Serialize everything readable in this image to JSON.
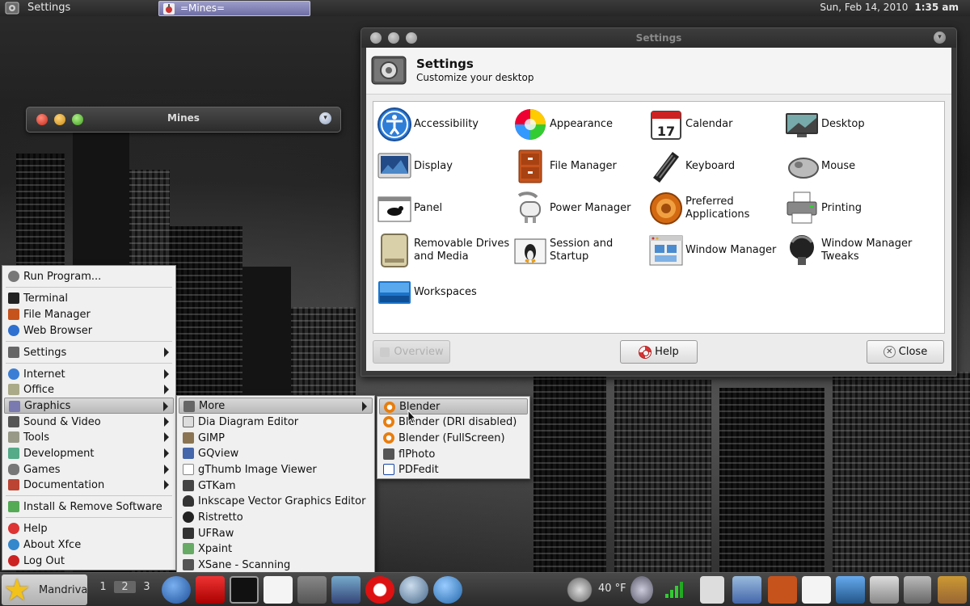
{
  "top_panel": {
    "app_title": "Settings",
    "task_button": "=Mines=",
    "date": "Sun, Feb 14, 2010",
    "time": "1:35 am"
  },
  "mines_window": {
    "title": "Mines"
  },
  "settings_window": {
    "title": "Settings",
    "header_title": "Settings",
    "header_subtitle": "Customize your desktop",
    "items": [
      {
        "label": "Accessibility",
        "icon": "accessibility-icon"
      },
      {
        "label": "Appearance",
        "icon": "appearance-icon"
      },
      {
        "label": "Calendar",
        "icon": "calendar-icon",
        "badge": "17"
      },
      {
        "label": "Desktop",
        "icon": "desktop-icon"
      },
      {
        "label": "Display",
        "icon": "display-icon"
      },
      {
        "label": "File Manager",
        "icon": "file-manager-icon"
      },
      {
        "label": "Keyboard",
        "icon": "keyboard-icon"
      },
      {
        "label": "Mouse",
        "icon": "mouse-icon"
      },
      {
        "label": "Panel",
        "icon": "panel-icon"
      },
      {
        "label": "Power Manager",
        "icon": "power-manager-icon"
      },
      {
        "label": "Preferred Applications",
        "icon": "preferred-applications-icon"
      },
      {
        "label": "Printing",
        "icon": "printing-icon"
      },
      {
        "label": "Removable Drives and Media",
        "icon": "removable-drives-icon"
      },
      {
        "label": "Session and Startup",
        "icon": "session-startup-icon"
      },
      {
        "label": "Window Manager",
        "icon": "window-manager-icon"
      },
      {
        "label": "Window Manager Tweaks",
        "icon": "window-manager-tweaks-icon"
      },
      {
        "label": "Workspaces",
        "icon": "workspaces-icon"
      }
    ],
    "buttons": {
      "overview": "Overview",
      "help": "Help",
      "close": "Close"
    }
  },
  "main_menu": {
    "items": [
      {
        "label": "Run Program...",
        "icon": "run-icon"
      },
      {
        "label": "Terminal",
        "icon": "terminal-icon"
      },
      {
        "label": "File Manager",
        "icon": "file-manager-icon"
      },
      {
        "label": "Web Browser",
        "icon": "web-browser-icon"
      },
      {
        "label": "Settings",
        "icon": "settings-icon",
        "submenu": true
      },
      {
        "label": "Internet",
        "icon": "internet-icon",
        "submenu": true
      },
      {
        "label": "Office",
        "icon": "office-icon",
        "submenu": true
      },
      {
        "label": "Graphics",
        "icon": "graphics-icon",
        "submenu": true
      },
      {
        "label": "Sound & Video",
        "icon": "sound-video-icon",
        "submenu": true
      },
      {
        "label": "Tools",
        "icon": "tools-icon",
        "submenu": true
      },
      {
        "label": "Development",
        "icon": "development-icon",
        "submenu": true
      },
      {
        "label": "Games",
        "icon": "games-icon",
        "submenu": true
      },
      {
        "label": "Documentation",
        "icon": "documentation-icon",
        "submenu": true
      },
      {
        "label": "Install & Remove Software",
        "icon": "install-icon"
      },
      {
        "label": "Help",
        "icon": "help-icon"
      },
      {
        "label": "About Xfce",
        "icon": "about-icon"
      },
      {
        "label": "Log Out",
        "icon": "logout-icon"
      }
    ]
  },
  "graphics_menu": {
    "items": [
      {
        "label": "More",
        "submenu": true
      },
      {
        "label": "Dia Diagram Editor"
      },
      {
        "label": "GIMP"
      },
      {
        "label": "GQview"
      },
      {
        "label": "gThumb Image Viewer"
      },
      {
        "label": "GTKam"
      },
      {
        "label": "Inkscape Vector Graphics Editor"
      },
      {
        "label": "Ristretto"
      },
      {
        "label": "UFRaw"
      },
      {
        "label": "Xpaint"
      },
      {
        "label": "XSane - Scanning"
      }
    ]
  },
  "more_menu": {
    "items": [
      {
        "label": "Blender"
      },
      {
        "label": "Blender (DRI disabled)"
      },
      {
        "label": "Blender (FullScreen)"
      },
      {
        "label": "flPhoto"
      },
      {
        "label": "PDFedit"
      }
    ]
  },
  "bottom_panel": {
    "start_label": "Mandriva",
    "workspaces": [
      "1",
      "2",
      "3"
    ],
    "weather": "40 °F",
    "colors": {
      "menu_bg": "#f0f0f0",
      "selection": "#c4c4c4"
    }
  }
}
